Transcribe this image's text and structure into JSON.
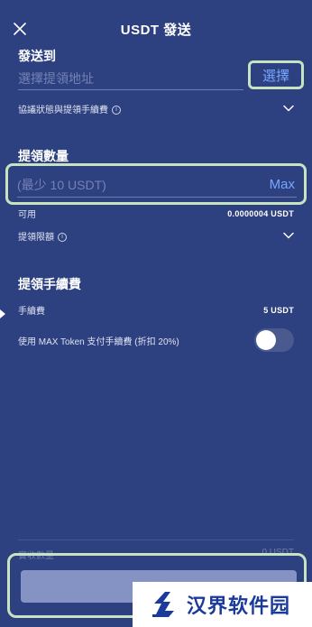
{
  "header": {
    "title": "USDT 發送"
  },
  "send_to": {
    "section_label": "發送到",
    "address_placeholder": "選擇提領地址",
    "select_button": "選擇",
    "protocol_label": "協議狀態與提領手續費"
  },
  "amount": {
    "section_label": "提領數量",
    "placeholder": "(最少 10 USDT)",
    "max_button": "Max",
    "available_label": "可用",
    "available_value": "0.0000004 USDT",
    "limit_label": "提領限額"
  },
  "fee": {
    "section_label": "提領手續費",
    "fee_label": "手續費",
    "fee_value": "5 USDT",
    "max_token_label": "使用 MAX Token 支付手續費 (折扣 20%)",
    "max_token_enabled": false
  },
  "footer": {
    "received_label": "實收數量",
    "received_value": "0 USDT",
    "submit_button": "送出"
  },
  "watermark": {
    "text": "汉界软件园"
  },
  "colors": {
    "background": "#2d4080",
    "accent": "#78a6ff",
    "highlight_outline": "#c8e3c0",
    "submit_button": "#8492c4"
  }
}
